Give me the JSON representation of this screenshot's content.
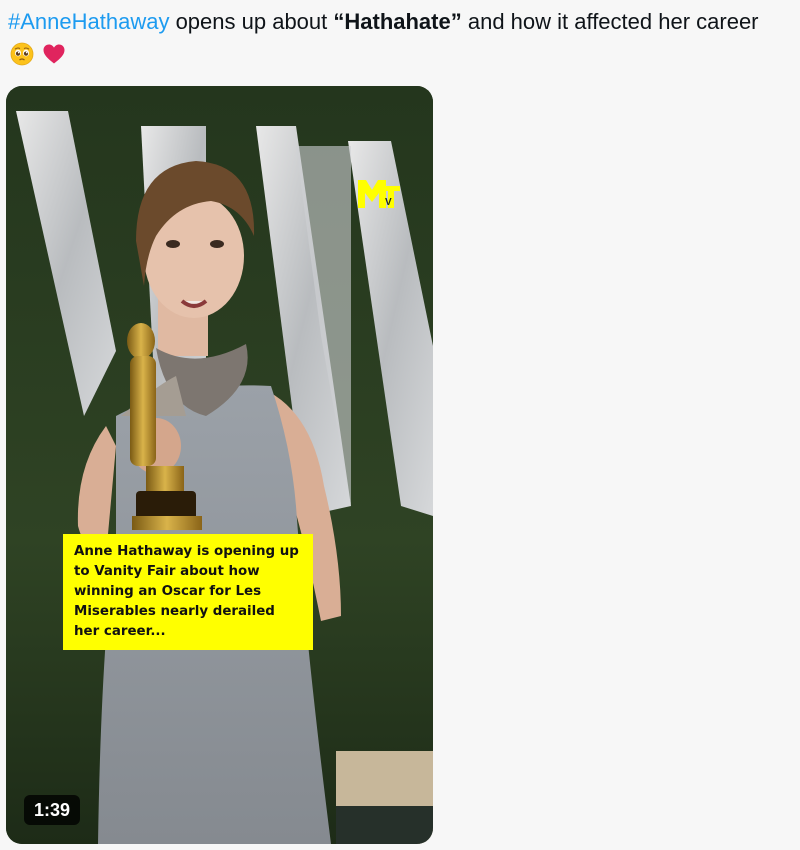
{
  "tweet": {
    "hashtag": "#AnneHathaway",
    "text_before_bold": " opens up about ",
    "bold_text": "“Hathahate”",
    "text_after_bold": " and how it affected her career",
    "emojis": [
      "pleading-face-emoji",
      "red-heart-emoji"
    ]
  },
  "video": {
    "caption": "Anne Hathaway is opening up to Vanity Fair about how winning an Oscar for Les Miserables nearly derailed her career...",
    "duration": "1:39",
    "logo": "MTV",
    "caption_color": "#ffff00"
  },
  "colors": {
    "hashtag": "#1d9bf0",
    "background": "#f7f7f7",
    "text": "#0f1419"
  }
}
